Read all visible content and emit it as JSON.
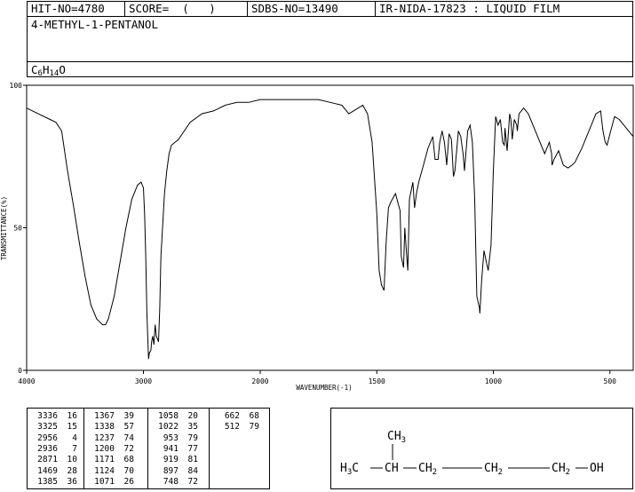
{
  "header": {
    "hit_no": "HIT-NO=4780",
    "score": "SCORE=  (   )",
    "sdbs_no": "SDBS-NO=13490",
    "ir_nida": "IR-NIDA-17823 : LIQUID FILM",
    "compound_name": "4-METHYL-1-PENTANOL",
    "formula": {
      "c": "C",
      "c_n": "6",
      "h": "H",
      "h_n": "14",
      "o": "O"
    }
  },
  "chart_data": {
    "type": "line",
    "xlabel": "WAVENUMBER(-1)",
    "ylabel": "TRANSMITTANCE(%)",
    "xlim": [
      4000,
      400
    ],
    "ylim": [
      0,
      100
    ],
    "x_ticks": [
      {
        "value": 4000,
        "label": "4000"
      },
      {
        "value": 3000,
        "label": "3000"
      },
      {
        "value": 2000,
        "label": "2000"
      },
      {
        "value": 1500,
        "label": "1500"
      },
      {
        "value": 1000,
        "label": "1000"
      },
      {
        "value": 500,
        "label": "500"
      }
    ],
    "y_ticks": [
      {
        "value": 0,
        "label": "0"
      },
      {
        "value": 50,
        "label": "50"
      },
      {
        "value": 100,
        "label": "100"
      }
    ],
    "series": [
      {
        "x": [
          4000,
          3900,
          3800,
          3750,
          3700,
          3650,
          3600,
          3550,
          3500,
          3450,
          3400,
          3350,
          3336,
          3325,
          3300,
          3250,
          3200,
          3150,
          3100,
          3050,
          3020,
          3000,
          2990,
          2980,
          2970,
          2960,
          2956,
          2950,
          2936,
          2930,
          2920,
          2910,
          2900,
          2890,
          2880,
          2871,
          2860,
          2850,
          2820,
          2800,
          2780,
          2760,
          2700,
          2650,
          2600,
          2500,
          2400,
          2300,
          2200,
          2100,
          2000,
          1900,
          1800,
          1750,
          1700,
          1650,
          1620,
          1600,
          1560,
          1540,
          1520,
          1500,
          1490,
          1480,
          1469,
          1460,
          1450,
          1440,
          1420,
          1400,
          1395,
          1385,
          1380,
          1370,
          1367,
          1360,
          1345,
          1338,
          1330,
          1320,
          1300,
          1280,
          1260,
          1250,
          1237,
          1230,
          1220,
          1210,
          1200,
          1190,
          1180,
          1171,
          1165,
          1150,
          1140,
          1130,
          1124,
          1110,
          1100,
          1090,
          1080,
          1071,
          1068,
          1060,
          1058,
          1050,
          1040,
          1030,
          1022,
          1010,
          1000,
          990,
          980,
          970,
          960,
          953,
          950,
          941,
          930,
          925,
          919,
          910,
          900,
          897,
          890,
          880,
          870,
          860,
          850,
          840,
          820,
          800,
          780,
          760,
          750,
          748,
          740,
          720,
          700,
          680,
          662,
          650,
          620,
          600,
          580,
          560,
          540,
          530,
          520,
          512,
          500,
          480,
          460,
          440,
          420,
          400
        ],
        "y": [
          92,
          90,
          88,
          87,
          84,
          70,
          58,
          45,
          33,
          23,
          18,
          16,
          16,
          16,
          18,
          26,
          38,
          50,
          60,
          65,
          66,
          64,
          55,
          40,
          20,
          8,
          4,
          6,
          7,
          10,
          12,
          9,
          16,
          12,
          11,
          10,
          22,
          40,
          62,
          70,
          76,
          79,
          81,
          84,
          87,
          90,
          91,
          93,
          94,
          94,
          95,
          95,
          95,
          95,
          94,
          93,
          90,
          91,
          93,
          90,
          80,
          55,
          35,
          30,
          28,
          45,
          57,
          59,
          62,
          56,
          40,
          36,
          50,
          38,
          35,
          60,
          66,
          57,
          62,
          66,
          72,
          78,
          82,
          74,
          74,
          80,
          84,
          80,
          72,
          83,
          81,
          68,
          70,
          84,
          82,
          76,
          70,
          84,
          86,
          80,
          60,
          26,
          25,
          22,
          20,
          32,
          42,
          38,
          35,
          44,
          70,
          89,
          86,
          88,
          80,
          79,
          85,
          77,
          90,
          88,
          81,
          88,
          86,
          84,
          90,
          91,
          92,
          91,
          90,
          88,
          84,
          80,
          76,
          80,
          76,
          72,
          74,
          77,
          72,
          71,
          72,
          73,
          78,
          82,
          86,
          90,
          91,
          84,
          80,
          79,
          83,
          89,
          88,
          86,
          84,
          82
        ]
      }
    ]
  },
  "peak_table": {
    "columns": [
      [
        [
          "3336",
          "16"
        ],
        [
          "3325",
          "15"
        ],
        [
          "2956",
          "4"
        ],
        [
          "2936",
          "7"
        ],
        [
          "2871",
          "10"
        ],
        [
          "1469",
          "28"
        ],
        [
          "1385",
          "36"
        ]
      ],
      [
        [
          "1367",
          "39"
        ],
        [
          "1338",
          "57"
        ],
        [
          "1237",
          "74"
        ],
        [
          "1200",
          "72"
        ],
        [
          "1171",
          "68"
        ],
        [
          "1124",
          "70"
        ],
        [
          "1071",
          "26"
        ]
      ],
      [
        [
          "1058",
          "20"
        ],
        [
          "1022",
          "35"
        ],
        [
          "953",
          "79"
        ],
        [
          "941",
          "77"
        ],
        [
          "919",
          "81"
        ],
        [
          "897",
          "84"
        ],
        [
          "748",
          "72"
        ]
      ],
      [
        [
          "662",
          "68"
        ],
        [
          "512",
          "79"
        ]
      ]
    ]
  },
  "structure": {
    "ch3": "CH",
    "ch3_n": "3",
    "h3c": "H",
    "h3c_n": "3",
    "h3c_c": "C",
    "ch": "CH",
    "ch2": "CH",
    "ch2_n": "2",
    "oh": "OH"
  }
}
